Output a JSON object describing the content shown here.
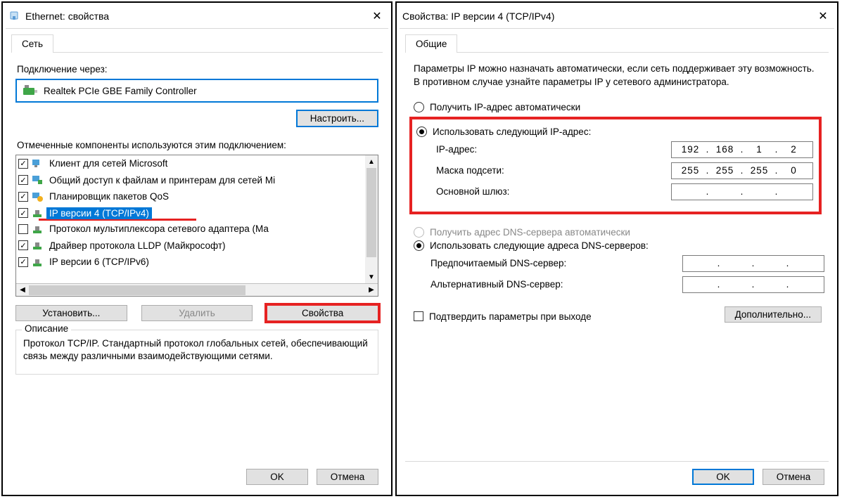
{
  "left": {
    "title": "Ethernet: свойства",
    "tab": "Сеть",
    "connect_via_label": "Подключение через:",
    "adapter_name": "Realtek PCIe GBE Family Controller",
    "configure_btn": "Настроить...",
    "components_label": "Отмеченные компоненты используются этим подключением:",
    "components": [
      {
        "checked": true,
        "label": "Клиент для сетей Microsoft",
        "icon": "client",
        "selected": false
      },
      {
        "checked": true,
        "label": "Общий доступ к файлам и принтерам для сетей Mi",
        "icon": "share",
        "selected": false
      },
      {
        "checked": true,
        "label": "Планировщик пакетов QoS",
        "icon": "qos",
        "selected": false
      },
      {
        "checked": true,
        "label": "IP версии 4 (TCP/IPv4)",
        "icon": "proto",
        "selected": true
      },
      {
        "checked": false,
        "label": "Протокол мультиплексора сетевого адаптера (Ма",
        "icon": "proto",
        "selected": false
      },
      {
        "checked": true,
        "label": "Драйвер протокола LLDP (Майкрософт)",
        "icon": "proto",
        "selected": false
      },
      {
        "checked": true,
        "label": "IP версии 6 (TCP/IPv6)",
        "icon": "proto",
        "selected": false
      }
    ],
    "install_btn": "Установить...",
    "remove_btn": "Удалить",
    "props_btn": "Свойства",
    "desc_title": "Описание",
    "desc_text": "Протокол TCP/IP. Стандартный протокол глобальных сетей, обеспечивающий связь между различными взаимодействующими сетями.",
    "ok_btn": "OK",
    "cancel_btn": "Отмена"
  },
  "right": {
    "title": "Свойства: IP версии 4 (TCP/IPv4)",
    "tab": "Общие",
    "intro": "Параметры IP можно назначать автоматически, если сеть поддерживает эту возможность. В противном случае узнайте параметры IP у сетевого администратора.",
    "auto_ip": "Получить IP-адрес автоматически",
    "manual_ip": "Использовать следующий IP-адрес:",
    "ip_label": "IP-адрес:",
    "ip_value": [
      "192",
      "168",
      "1",
      "2"
    ],
    "mask_label": "Маска подсети:",
    "mask_value": [
      "255",
      "255",
      "255",
      "0"
    ],
    "gw_label": "Основной шлюз:",
    "gw_value": [
      "",
      "",
      "",
      ""
    ],
    "auto_dns": "Получить адрес DNS-сервера автоматически",
    "manual_dns": "Использовать следующие адреса DNS-серверов:",
    "pref_dns_label": "Предпочитаемый DNS-сервер:",
    "pref_dns_value": [
      "",
      "",
      "",
      ""
    ],
    "alt_dns_label": "Альтернативный DNS-сервер:",
    "alt_dns_value": [
      "",
      "",
      "",
      ""
    ],
    "confirm_label": "Подтвердить параметры при выходе",
    "adv_btn": "Дополнительно...",
    "ok_btn": "OK",
    "cancel_btn": "Отмена"
  }
}
